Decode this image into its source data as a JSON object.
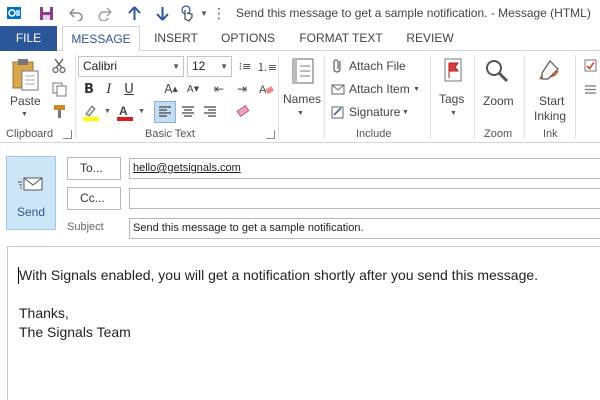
{
  "window": {
    "title": "Send this message to get a sample notification. - Message (HTML)"
  },
  "tabs": [
    {
      "label": "FILE"
    },
    {
      "label": "MESSAGE"
    },
    {
      "label": "INSERT"
    },
    {
      "label": "OPTIONS"
    },
    {
      "label": "FORMAT TEXT"
    },
    {
      "label": "REVIEW"
    }
  ],
  "ribbon": {
    "clipboard": {
      "paste_label": "Paste",
      "group_label": "Clipboard"
    },
    "basic_text": {
      "font_name": "Calibri",
      "font_size": "12",
      "group_label": "Basic Text"
    },
    "names": {
      "label": "Names"
    },
    "include": {
      "attach_file": "Attach File",
      "attach_item": "Attach Item",
      "signature": "Signature",
      "group_label": "Include"
    },
    "tags": {
      "label": "Tags"
    },
    "zoom": {
      "label": "Zoom",
      "group_label": "Zoom"
    },
    "ink": {
      "start_inking_line1": "Start",
      "start_inking_line2": "Inking",
      "group_label": "Ink"
    }
  },
  "compose": {
    "send_label": "Send",
    "to_label": "To...",
    "cc_label": "Cc...",
    "subject_label": "Subject",
    "to_value": "hello@getsignals.com",
    "cc_value": "",
    "subject_value": "Send this message to get a sample notification.",
    "body": {
      "line1": "With Signals enabled, you will get a notification shortly after you send this message.",
      "line2": "Thanks,",
      "line3": "The Signals Team"
    }
  }
}
